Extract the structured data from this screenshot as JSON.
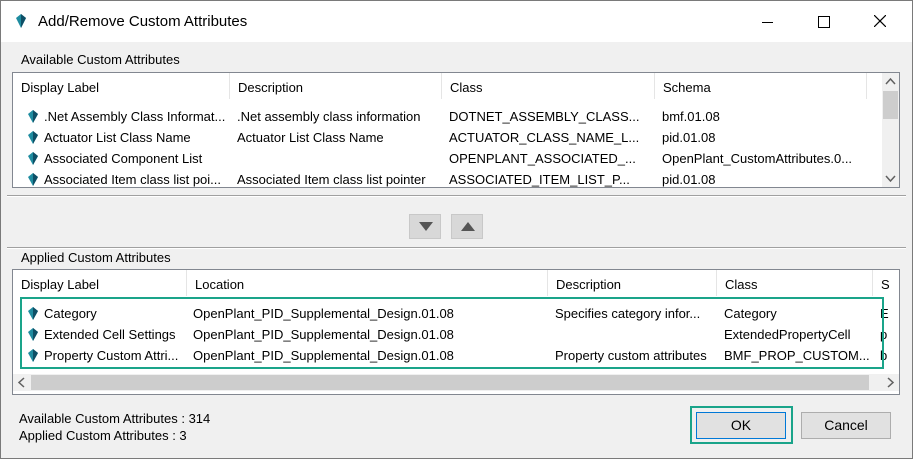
{
  "window": {
    "title": "Add/Remove Custom Attributes",
    "icon": "diamond-app-icon",
    "controls": {
      "minimize": "minimize-icon",
      "maximize": "maximize-icon",
      "close": "close-icon"
    }
  },
  "available": {
    "group_label": "Available Custom Attributes",
    "columns": [
      "Display Label",
      "Description",
      "Class",
      "Schema"
    ],
    "rows": [
      {
        "label": ".Net Assembly Class Informat...",
        "description": ".Net assembly class information",
        "class": "DOTNET_ASSEMBLY_CLASS...",
        "schema": "bmf.01.08"
      },
      {
        "label": "Actuator List Class Name",
        "description": "Actuator List Class Name",
        "class": "ACTUATOR_CLASS_NAME_L...",
        "schema": "pid.01.08"
      },
      {
        "label": "Associated Component List",
        "description": "",
        "class": "OPENPLANT_ASSOCIATED_...",
        "schema": "OpenPlant_CustomAttributes.0..."
      },
      {
        "label": "Associated Item class list poi...",
        "description": "Associated Item class list pointer",
        "class": "ASSOCIATED_ITEM_LIST_P...",
        "schema": "pid.01.08"
      }
    ]
  },
  "move": {
    "down_icon": "triangle-down-icon",
    "up_icon": "triangle-up-icon"
  },
  "applied": {
    "group_label": "Applied Custom Attributes",
    "columns": [
      "Display Label",
      "Location",
      "Description",
      "Class",
      "S"
    ],
    "rows": [
      {
        "label": "Category",
        "location": "OpenPlant_PID_Supplemental_Design.01.08",
        "description": "Specifies category infor...",
        "class": "Category",
        "extra": "E"
      },
      {
        "label": "Extended Cell Settings",
        "location": "OpenPlant_PID_Supplemental_Design.01.08",
        "description": "",
        "class": "ExtendedPropertyCell",
        "extra": "p"
      },
      {
        "label": "Property Custom Attri...",
        "location": "OpenPlant_PID_Supplemental_Design.01.08",
        "description": "Property custom attributes",
        "class": "BMF_PROP_CUSTOM...",
        "extra": "b"
      }
    ]
  },
  "status": {
    "available_count": "Available Custom Attributes : 314",
    "applied_count": "Applied Custom Attributes : 3"
  },
  "buttons": {
    "ok": "OK",
    "cancel": "Cancel"
  },
  "colors": {
    "highlight": "#1aa48a",
    "icon_teal": "#1f8ca0",
    "icon_dark": "#0e4f66"
  }
}
